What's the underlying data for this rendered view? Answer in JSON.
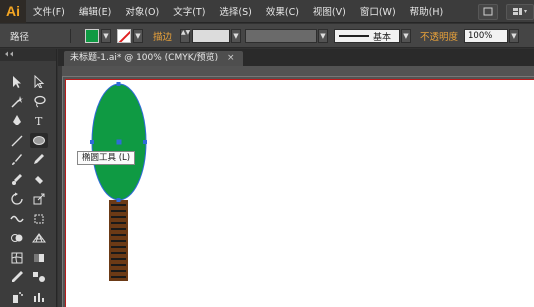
{
  "app": {
    "logo": "Ai"
  },
  "menu": [
    "文件(F)",
    "编辑(E)",
    "对象(O)",
    "文字(T)",
    "选择(S)",
    "效果(C)",
    "视图(V)",
    "窗口(W)",
    "帮助(H)"
  ],
  "control_bar": {
    "object_label": "路径",
    "fill_color": "#0f9a43",
    "stroke_label": "描边",
    "stroke_weight_arrows": "▲▼",
    "brush_label": "基本",
    "opacity_label": "不透明度",
    "opacity_value": "100%",
    "dropdown_glyph": "▼"
  },
  "document": {
    "tab_title": "未标题-1.ai* @ 100% (CMYK/预览)",
    "close_glyph": "×"
  },
  "tooltip": {
    "text": "椭圆工具 (L)"
  },
  "colors": {
    "tree_crown": "#0f9a43",
    "tree_trunk": "#6b3a16",
    "trunk_stripes": "#1a1a1a",
    "selection_blue": "#2f6bd9",
    "artboard_border": "#b91c1c"
  },
  "icons": [
    "selection-icon",
    "direct-selection-icon",
    "magic-wand-icon",
    "lasso-icon",
    "pen-icon",
    "type-icon",
    "line-segment-icon",
    "ellipse-icon",
    "paintbrush-icon",
    "pencil-icon",
    "blob-brush-icon",
    "eraser-icon",
    "rotate-icon",
    "scale-icon",
    "width-icon",
    "free-transform-icon",
    "shape-builder-icon",
    "perspective-grid-icon",
    "mesh-icon",
    "gradient-icon",
    "eyedropper-icon",
    "blend-icon",
    "symbol-sprayer-icon",
    "column-graph-icon"
  ]
}
